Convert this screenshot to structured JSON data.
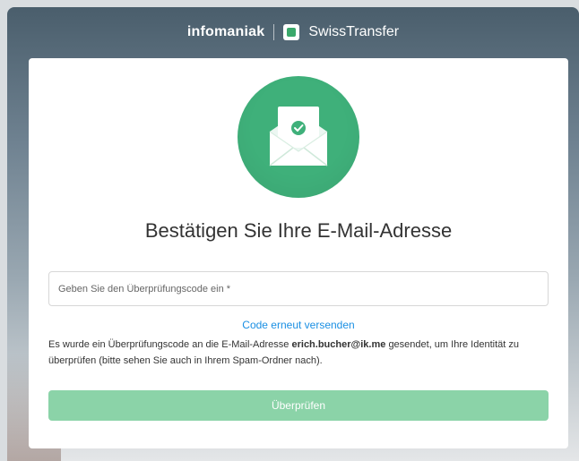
{
  "header": {
    "brand_infomaniak": "infomaniak",
    "brand_product": "SwissTransfer"
  },
  "verify": {
    "title": "Bestätigen Sie Ihre E-Mail-Adresse",
    "code_placeholder": "Geben Sie den Überprüfungscode ein *",
    "code_value": "",
    "resend_link": "Code erneut versenden",
    "info_prefix": "Es wurde ein Überprüfungscode an die E-Mail-Adresse",
    "email": "erich.bucher@ik.me",
    "info_suffix": "gesendet, um Ihre Identität zu überprüfen (bitte sehen Sie auch in Ihrem Spam-Ordner nach).",
    "submit_label": "Überprüfen"
  },
  "colors": {
    "brand_green": "#3fb07a",
    "button_disabled_green": "#8bd3a8",
    "link_blue": "#1a8fe3"
  },
  "icons": {
    "hero": "envelope-check-icon",
    "product_logo": "swisstransfer-logo-icon"
  }
}
